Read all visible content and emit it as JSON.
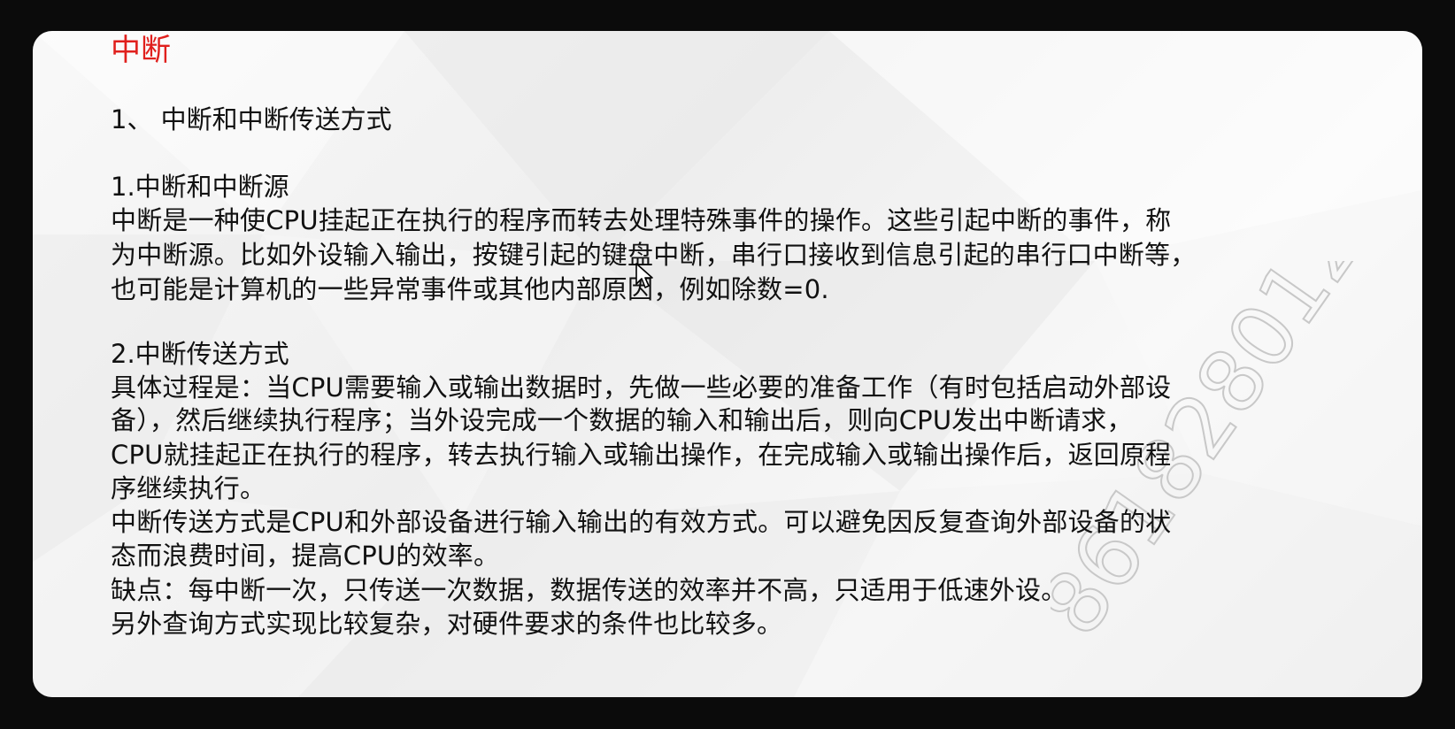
{
  "slide": {
    "title": "中断",
    "section_heading": "1、 中断和中断传送方式",
    "sub1": {
      "heading": "1.中断和中断源",
      "lines": [
        "中断是一种使CPU挂起正在执行的程序而转去处理特殊事件的操作。这些引起中断的事件，称",
        "为中断源。比如外设输入输出，按键引起的键盘中断，串行口接收到信息引起的串行口中断等，",
        "也可能是计算机的一些异常事件或其他内部原因，例如除数=0."
      ]
    },
    "sub2": {
      "heading": "2.中断传送方式",
      "lines": [
        "具体过程是：当CPU需要输入或输出数据时，先做一些必要的准备工作（有时包括启动外部设",
        "备），然后继续执行程序；当外设完成一个数据的输入和输出后，则向CPU发出中断请求，",
        "CPU就挂起正在执行的程序，转去执行输入或输出操作，在完成输入或输出操作后，返回原程",
        "序继续执行。",
        "中断传送方式是CPU和外部设备进行输入输出的有效方式。可以避免因反复查询外部设备的状",
        "态而浪费时间，提高CPU的效率。",
        "缺点：每中断一次，只传送一次数据，数据传送的效率并不高，只适用于低速外设。",
        "另外查询方式实现比较复杂，对硬件要求的条件也比较多。"
      ]
    },
    "watermark_text": "8618280123",
    "title_color": "#e0201d"
  }
}
